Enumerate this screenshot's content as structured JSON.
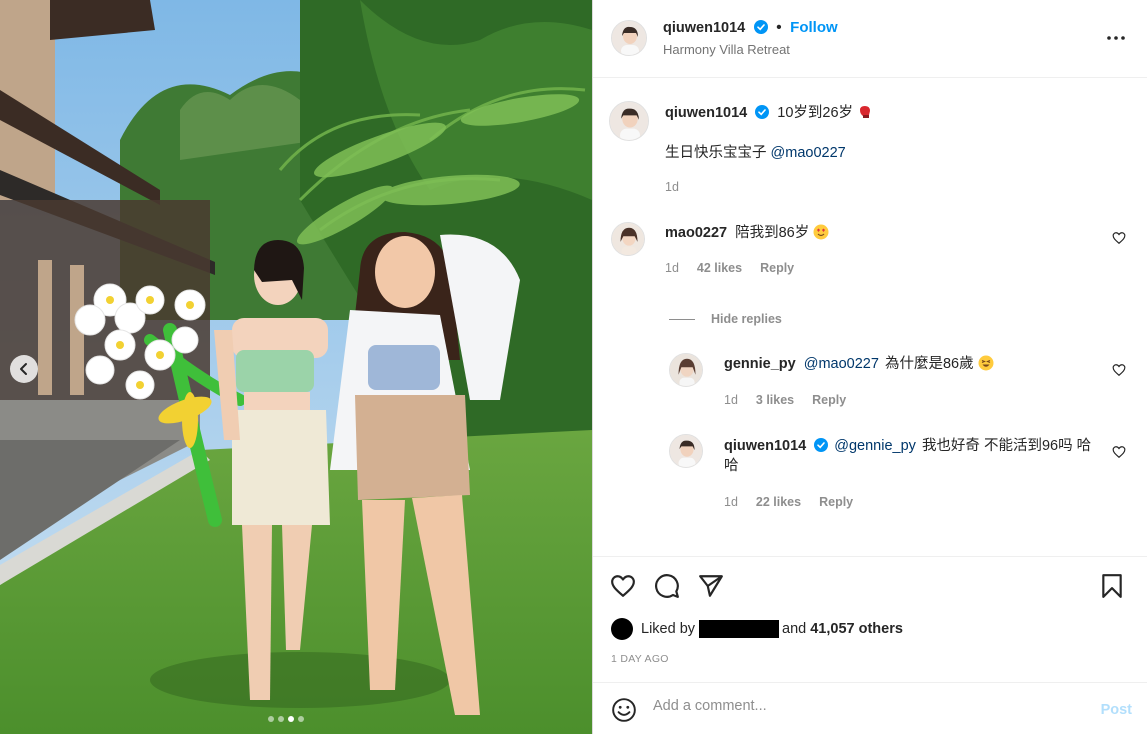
{
  "header": {
    "username": "qiuwen1014",
    "follow_label": "Follow",
    "location": "Harmony Villa Retreat"
  },
  "caption": {
    "username": "qiuwen1014",
    "title": "10岁到26岁",
    "body": "生日快乐宝宝子",
    "mention": "@mao0227",
    "time": "1d"
  },
  "comments": [
    {
      "username": "mao0227",
      "text": "陪我到86岁",
      "time": "1d",
      "likes": "42 likes",
      "reply_label": "Reply"
    }
  ],
  "hide_replies_label": "Hide replies",
  "replies": [
    {
      "username": "gennie_py",
      "mention": "@mao0227",
      "text": "為什麼是86歲",
      "time": "1d",
      "likes": "3 likes",
      "reply_label": "Reply"
    },
    {
      "username": "qiuwen1014",
      "mention": "@gennie_py",
      "text": "我也好奇 不能活到96吗 哈",
      "text2": "哈",
      "time": "1d",
      "likes": "22 likes",
      "reply_label": "Reply"
    }
  ],
  "likes": {
    "prefix": "Liked by",
    "suffix": "and",
    "others": "41,057 others"
  },
  "date": "1 DAY AGO",
  "composer": {
    "placeholder": "Add a comment...",
    "post_label": "Post"
  },
  "carousel": {
    "slides": 4,
    "active": 3
  },
  "icons": {
    "more": "more-horizontal-icon",
    "like": "heart-icon",
    "comment": "comment-icon",
    "share": "paper-plane-icon",
    "save": "bookmark-icon",
    "emoji": "emoji-smile-icon",
    "verified": "verified-badge-icon",
    "prev": "chevron-left-icon"
  },
  "colors": {
    "accent": "#0095f6",
    "verified": "#0095f6",
    "post_disabled": "#b2dffc"
  }
}
